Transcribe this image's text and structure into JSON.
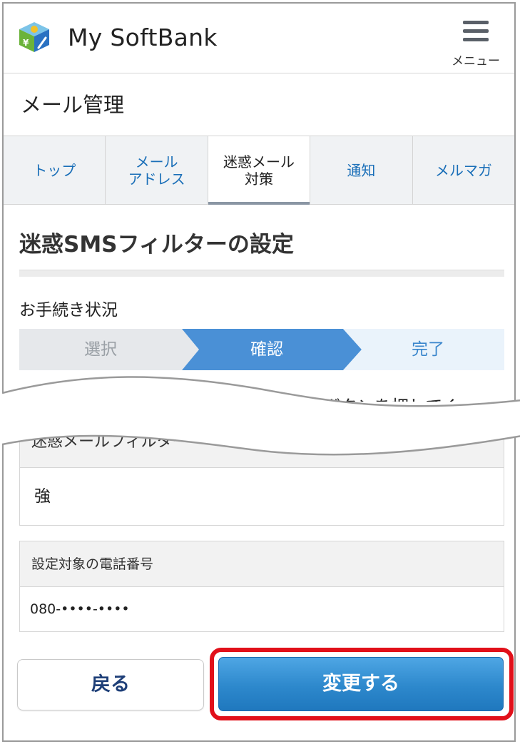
{
  "header": {
    "brand": "My SoftBank",
    "menu_label": "メニュー"
  },
  "section": {
    "title": "メール管理"
  },
  "tabs": [
    {
      "label": "トップ",
      "active": false
    },
    {
      "label": "メール\nアドレス",
      "active": false
    },
    {
      "label": "迷惑メール\n対策",
      "active": true
    },
    {
      "label": "通知",
      "active": false
    },
    {
      "label": "メルマガ",
      "active": false
    }
  ],
  "page": {
    "heading": "迷惑SMSフィルターの設定",
    "status_label": "お手続き状況",
    "steps": [
      {
        "label": "選択",
        "state": "done"
      },
      {
        "label": "確認",
        "state": "current"
      },
      {
        "label": "完了",
        "state": "upcoming"
      }
    ],
    "cutoff_text": "る」ボタンを押してく"
  },
  "fields": {
    "filter_header": "迷惑メールフィルター",
    "filter_value": "強",
    "phone_header": "設定対象の電話番号",
    "phone_value": "080-••••-••••"
  },
  "buttons": {
    "back": "戻る",
    "change": "変更する"
  },
  "colors": {
    "step_done": "#e6e8eb",
    "step_current": "#4a90d6",
    "step_upcoming": "#eaf3fb",
    "highlight": "#e1101a",
    "link": "#1a6fb8"
  }
}
